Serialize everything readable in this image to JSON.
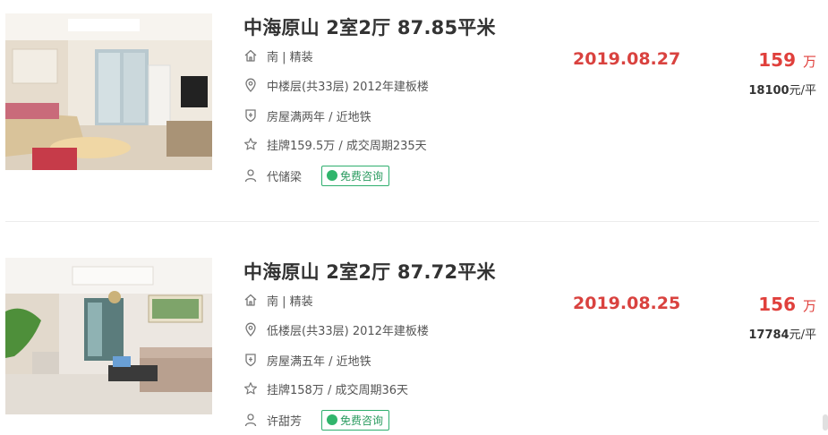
{
  "listings": [
    {
      "title": "中海原山 2室2厅 87.85平米",
      "orientation_decoration": "南 | 精装",
      "floor_info": "中楼层(共33层) 2012年建板楼",
      "tags": "房屋满两年 / 近地铁",
      "listing_info": "挂牌159.5万 / 成交周期235天",
      "agent": "代储梁",
      "consult_label": "免费咨询",
      "deal_date": "2019.08.27",
      "total_price": "159",
      "price_unit": "万",
      "unit_price": "18100",
      "unit_price_suffix": "元/平"
    },
    {
      "title": "中海原山 2室2厅 87.72平米",
      "orientation_decoration": "南 | 精装",
      "floor_info": "低楼层(共33层) 2012年建板楼",
      "tags": "房屋满五年 / 近地铁",
      "listing_info": "挂牌158万 / 成交周期36天",
      "agent": "许甜芳",
      "consult_label": "免费咨询",
      "deal_date": "2019.08.25",
      "total_price": "156",
      "price_unit": "万",
      "unit_price": "17784",
      "unit_price_suffix": "元/平"
    }
  ],
  "icons": {
    "house": "house-icon",
    "location": "location-pin-icon",
    "shield": "shield-icon",
    "star": "star-icon",
    "person": "person-icon",
    "chat": "chat-bubble-icon"
  },
  "colors": {
    "price_red": "#e0403c",
    "consult_green": "#2fae6e",
    "text_dark": "#333333",
    "text_muted": "#555555"
  }
}
